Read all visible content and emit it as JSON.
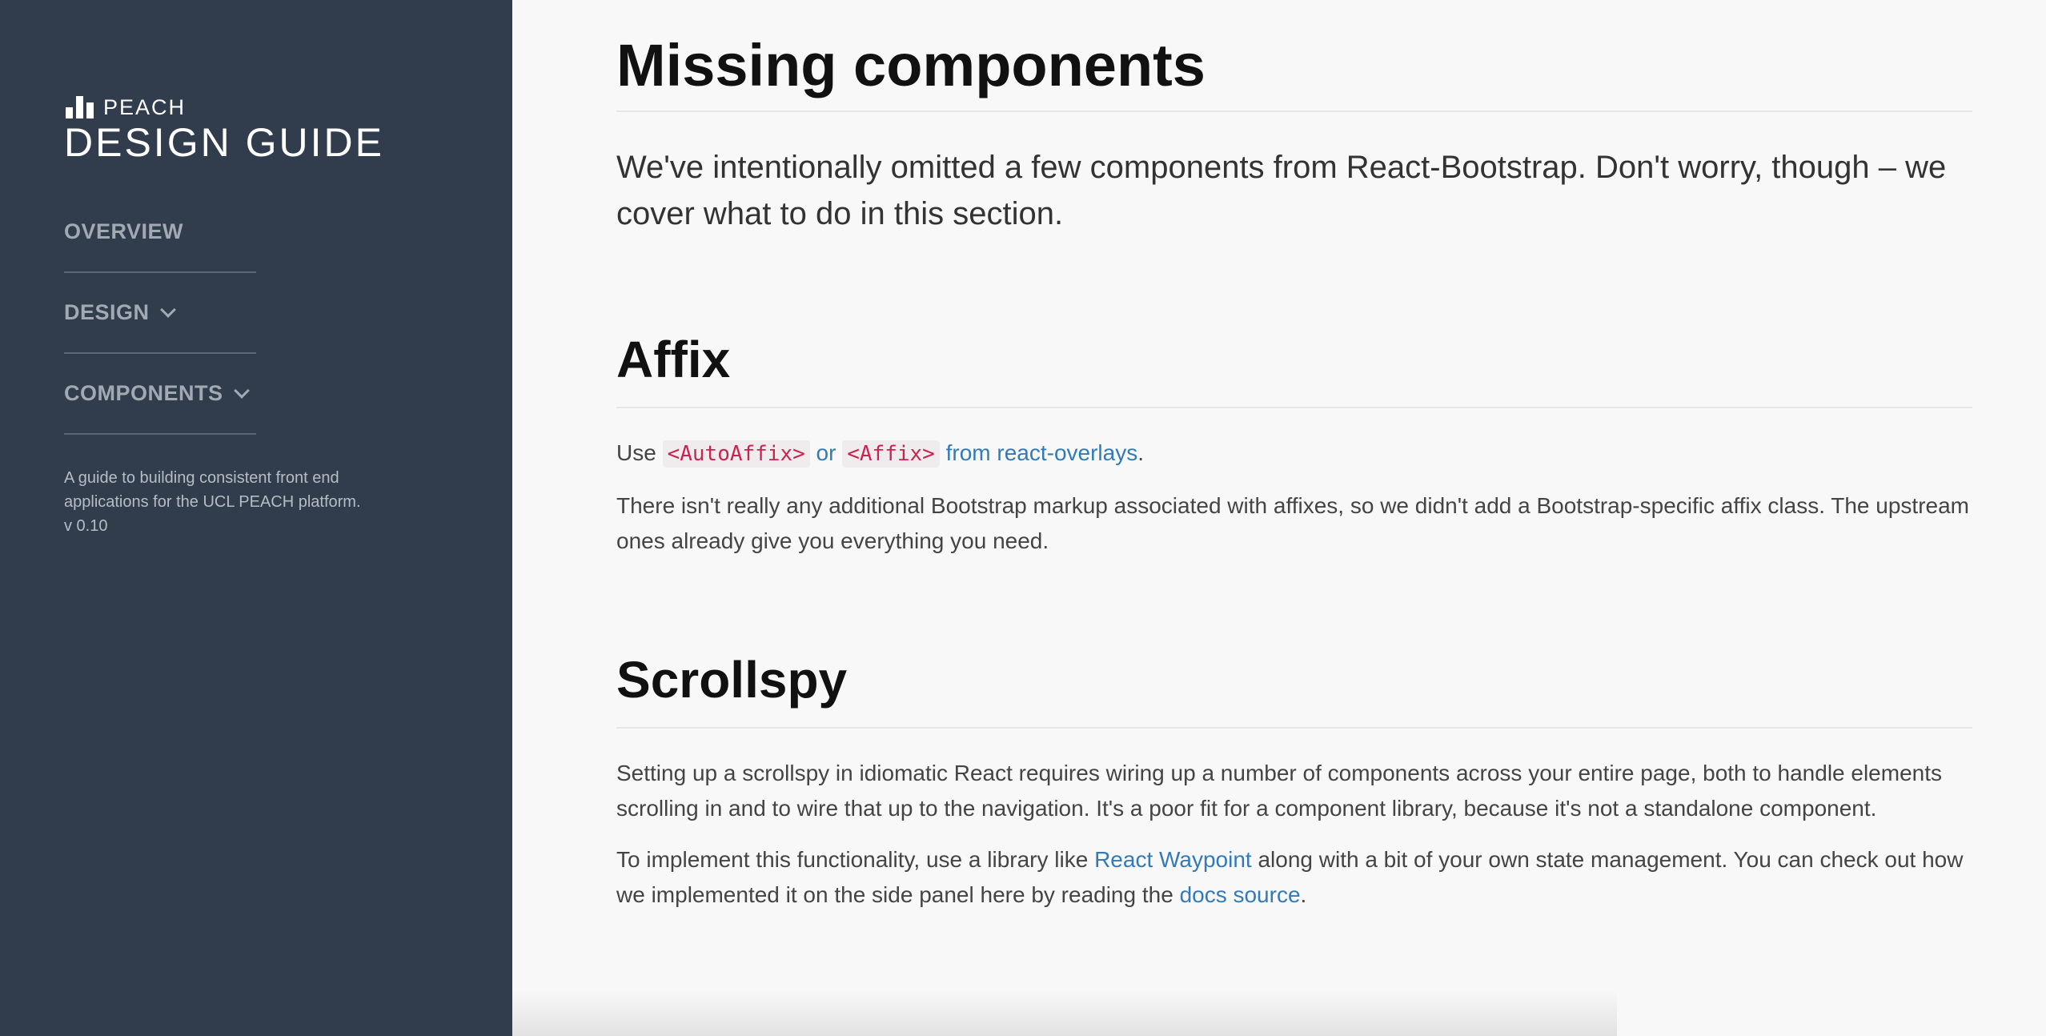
{
  "sidebar": {
    "logo_word": "PEACH",
    "title": "DESIGN GUIDE",
    "nav": [
      {
        "label": "OVERVIEW"
      },
      {
        "label": "DESIGN"
      },
      {
        "label": "COMPONENTS"
      }
    ],
    "description_line1": "A guide to building consistent front end",
    "description_line2": "applications for the UCL PEACH platform.",
    "version": "v 0.10"
  },
  "main": {
    "title": "Missing components",
    "lead": "We've intentionally omitted a few components from React-Bootstrap. Don't worry, though – we cover what to do in this section.",
    "affix": {
      "heading": "Affix",
      "use_prefix": "Use ",
      "code_autoaffix": "<AutoAffix>",
      "or_text": " or ",
      "code_affix": "<Affix>",
      "from_text": " from react-overlays",
      "period": ".",
      "para2": "There isn't really any additional Bootstrap markup associated with affixes, so we didn't add a Bootstrap-specific affix class. The upstream ones already give you everything you need."
    },
    "scrollspy": {
      "heading": "Scrollspy",
      "para1": "Setting up a scrollspy in idiomatic React requires wiring up a number of components across your entire page, both to handle elements scrolling in and to wire that up to the navigation. It's a poor fit for a component library, because it's not a standalone component.",
      "para2_prefix": "To implement this functionality, use a library like ",
      "waypoint_link": "React Waypoint",
      "para2_middle": " along with a bit of your own state management. You can check out how we implemented it on the side panel here by reading the ",
      "docs_link": "docs source",
      "para2_suffix": "."
    }
  },
  "colors": {
    "sidebar_bg": "#313d4d",
    "link": "#337ab7",
    "code": "#c7254e"
  }
}
